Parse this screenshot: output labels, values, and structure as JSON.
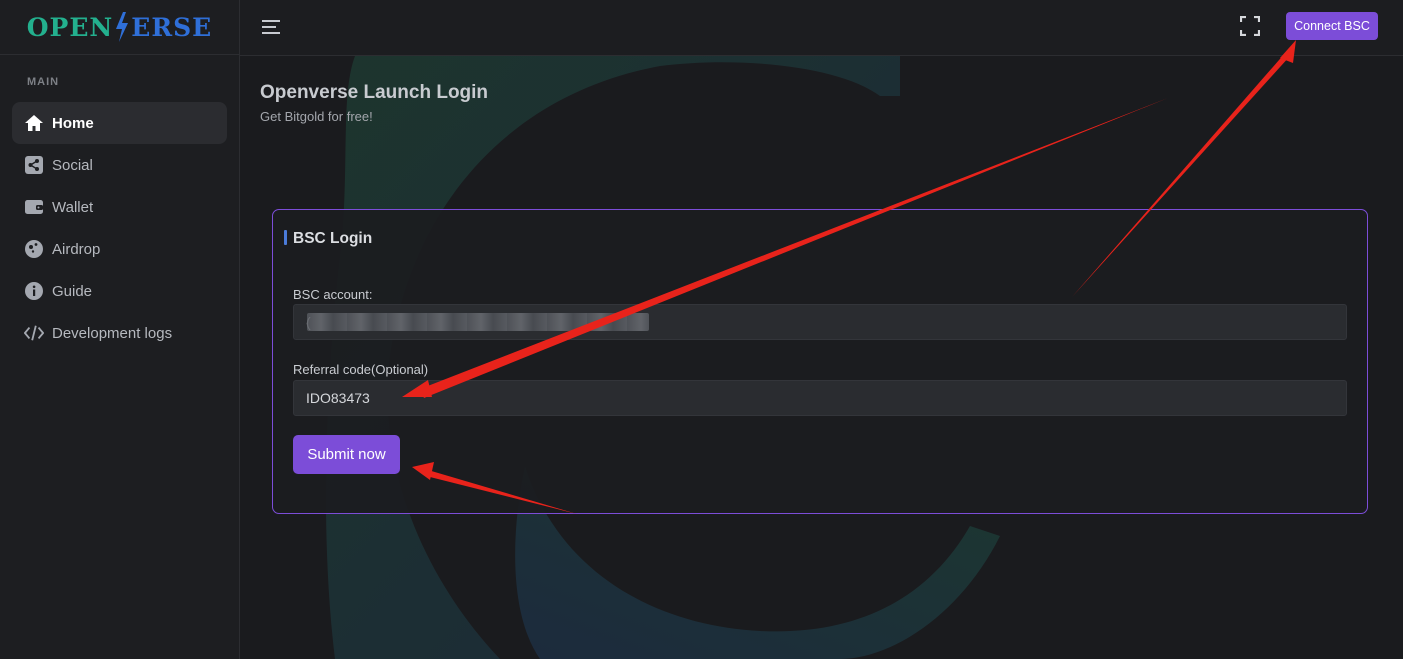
{
  "brand": {
    "part1": "OPEN",
    "part2": "ERSE"
  },
  "sidebar": {
    "section": "MAIN",
    "items": [
      {
        "label": "Home",
        "icon": "home-icon",
        "active": true
      },
      {
        "label": "Social",
        "icon": "share-icon",
        "active": false
      },
      {
        "label": "Wallet",
        "icon": "wallet-icon",
        "active": false
      },
      {
        "label": "Airdrop",
        "icon": "airdrop-icon",
        "active": false
      },
      {
        "label": "Guide",
        "icon": "info-icon",
        "active": false
      },
      {
        "label": "Development logs",
        "icon": "code-icon",
        "active": false
      }
    ]
  },
  "header": {
    "connect_label": "Connect BSC",
    "menu_icon": "hamburger-icon",
    "fullscreen_icon": "fullscreen-icon"
  },
  "page": {
    "title": "Openverse Launch Login",
    "subtitle": "Get Bitgold for free!"
  },
  "form": {
    "title": "BSC Login",
    "account_label": "BSC account:",
    "account_value": "(",
    "referral_label": "Referral code(Optional)",
    "referral_value": "IDO83473",
    "submit_label": "Submit now"
  },
  "colors": {
    "accent": "#7c4dd8",
    "logo_green": "#23b08e",
    "logo_blue": "#2f6fd8",
    "annotation_red": "#e8231b"
  }
}
